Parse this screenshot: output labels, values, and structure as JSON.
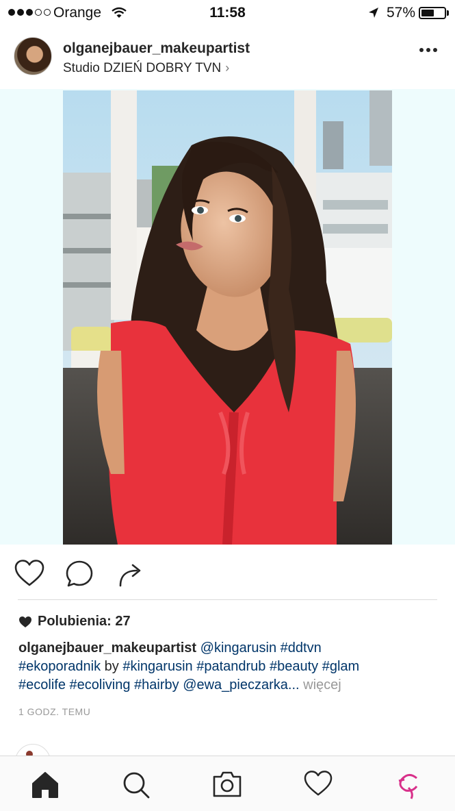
{
  "status_bar": {
    "carrier": "Orange",
    "time": "11:58",
    "battery_percent": "57%",
    "battery_level": 0.57
  },
  "post": {
    "username": "olganejbauer_makeupartist",
    "location": "Studio DZIEŃ DOBRY TVN",
    "likes_label": "Polubienia: 27",
    "caption": {
      "user": "olganejbauer_makeupartist",
      "line1_rest": "@kingarusin #ddtvn",
      "parts_line2": [
        "#ekoporadnik",
        "by",
        "#kingarusin",
        "#patandrub",
        "#beauty",
        "#glam"
      ],
      "parts_line3": [
        "#ecolife",
        "#ecoliving",
        "#hairby",
        "@ewa_pieczarka..."
      ],
      "more_label": "więcej"
    },
    "time_ago": "1 GODZ. TEMU"
  },
  "icons": {
    "status": [
      "signal-dots",
      "wifi-icon",
      "location-arrow-icon",
      "battery-icon"
    ],
    "actions": [
      "heart-icon",
      "comment-icon",
      "share-icon"
    ],
    "tabs": [
      "home-icon",
      "search-icon",
      "camera-icon",
      "activity-heart-icon",
      "profile-icon"
    ]
  },
  "colors": {
    "text": "#262626",
    "hashtag": "#003569",
    "muted": "#999999",
    "shirt": "#e8323c",
    "sky": "#c7e3f2"
  }
}
